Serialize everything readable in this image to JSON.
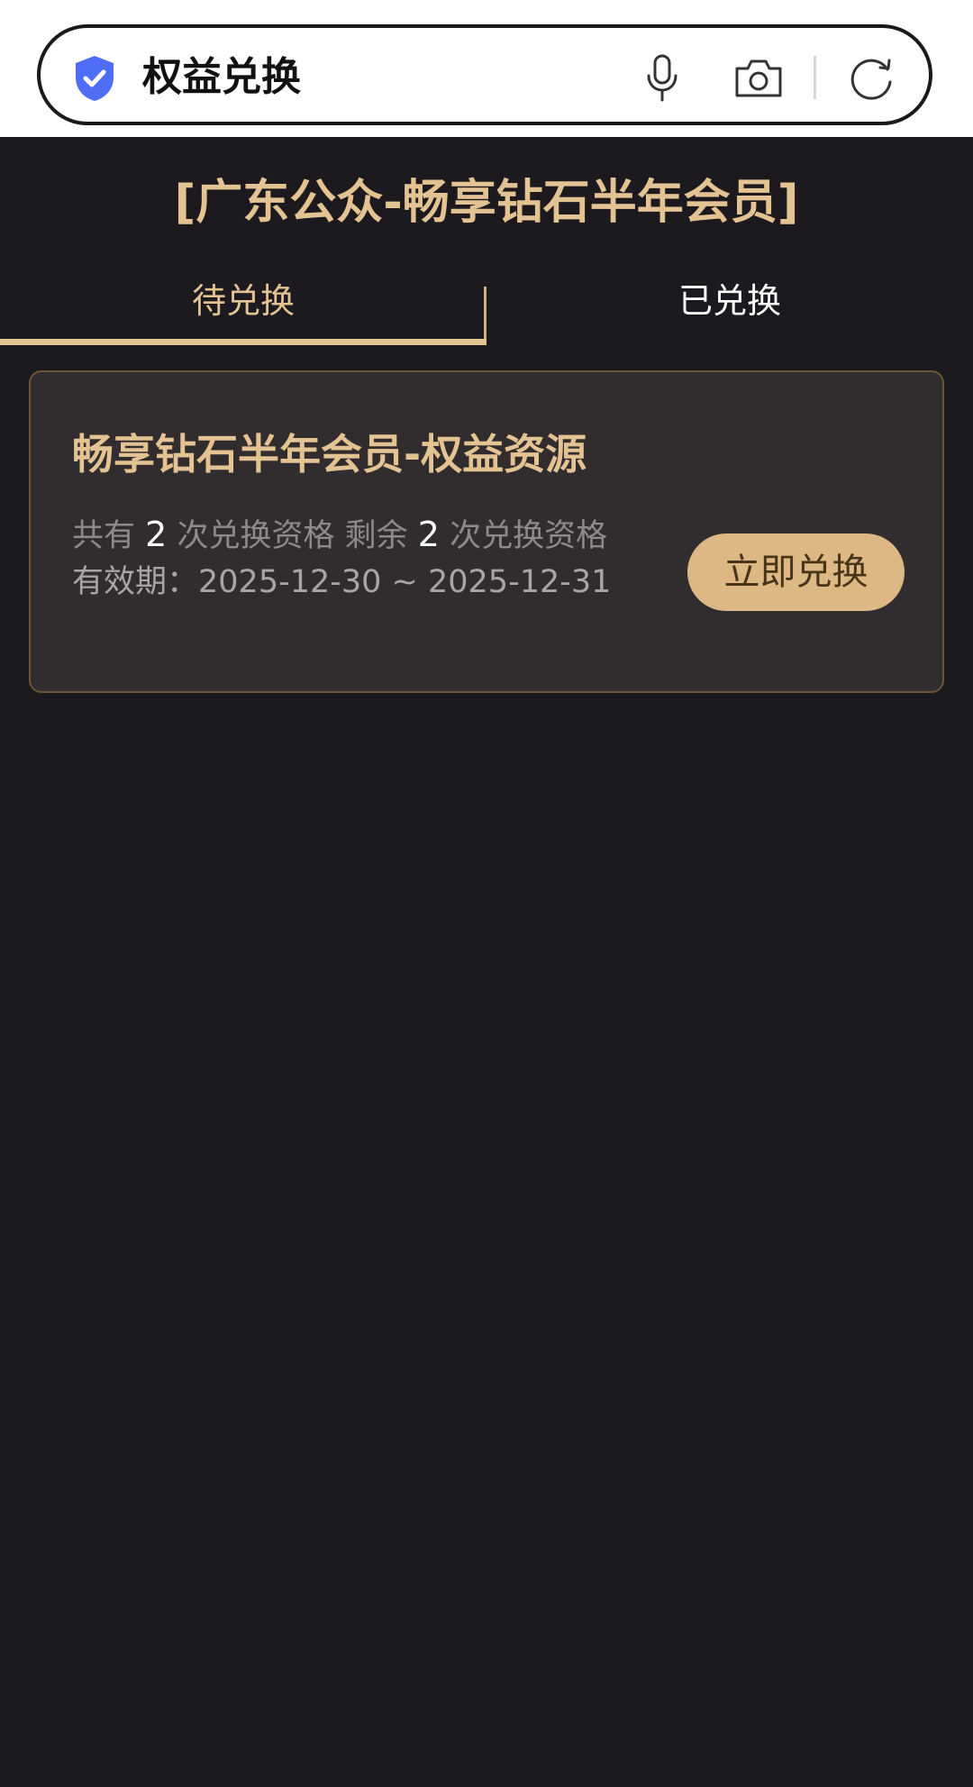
{
  "search": {
    "query": "权益兑换"
  },
  "page": {
    "title": "[广东公众-畅享钻石半年会员]"
  },
  "tabs": [
    {
      "label": "待兑换",
      "active": true
    },
    {
      "label": "已兑换",
      "active": false
    }
  ],
  "card": {
    "title": "畅享钻石半年会员-权益资源",
    "total_prefix": "共有",
    "total_count": "2",
    "total_suffix": "次兑换资格",
    "remaining_prefix": "剩余",
    "remaining_count": "2",
    "remaining_suffix": "次兑换资格",
    "validity_label": "有效期：",
    "validity_range": "2025-12-30 ~ 2025-12-31",
    "button_label": "立即兑换"
  },
  "colors": {
    "background": "#1c1a1f",
    "accent_gold": "#e4c393",
    "button_gold": "#ddb784",
    "shield_blue": "#4f6ef7"
  },
  "icons": [
    "shield-check-icon",
    "microphone-icon",
    "camera-icon",
    "refresh-icon"
  ]
}
